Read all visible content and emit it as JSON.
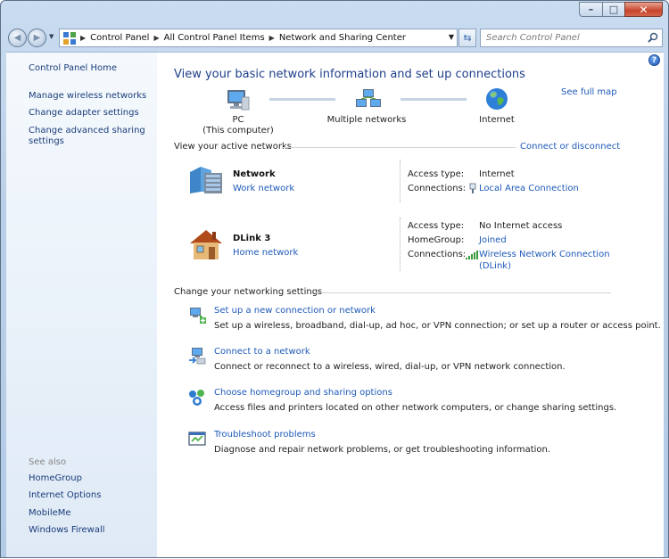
{
  "window": {
    "minimize_glyph": "–",
    "maximize_glyph": "□",
    "close_glyph": "✕"
  },
  "navbar": {
    "breadcrumbs": [
      "Control Panel",
      "All Control Panel Items",
      "Network and Sharing Center"
    ],
    "search_placeholder": "Search Control Panel"
  },
  "sidebar": {
    "home": "Control Panel Home",
    "links": [
      "Manage wireless networks",
      "Change adapter settings",
      "Change advanced sharing",
      "settings"
    ],
    "see_also_title": "See also",
    "see_also": [
      "HomeGroup",
      "Internet Options",
      "MobileMe",
      "Windows Firewall"
    ]
  },
  "main": {
    "title": "View your basic network information and set up connections",
    "see_full_map": "See full map",
    "map": {
      "pc_label": "PC",
      "pc_sub": "(This computer)",
      "middle_label": "Multiple networks",
      "internet_label": "Internet"
    },
    "active_header": "View your active networks",
    "connect_disconnect": "Connect or disconnect",
    "networks": [
      {
        "name": "Network",
        "type": "Work network",
        "access_type_label": "Access type:",
        "access_type": "Internet",
        "connections_label": "Connections:",
        "connection": "Local Area Connection"
      },
      {
        "name": "DLink  3",
        "type": "Home network",
        "access_type_label": "Access type:",
        "access_type": "No Internet access",
        "homegroup_label": "HomeGroup:",
        "homegroup": "Joined",
        "connections_label": "Connections:",
        "connection_line1": "Wireless Network Connection",
        "connection_line2": "(DLink)"
      }
    ],
    "settings_header": "Change your networking settings",
    "tasks": [
      {
        "link": "Set up a new connection or network",
        "desc": "Set up a wireless, broadband, dial-up, ad hoc, or VPN connection; or set up a router or access point.",
        "icon": "new-connection-icon"
      },
      {
        "link": "Connect to a network",
        "desc": "Connect or reconnect to a wireless, wired, dial-up, or VPN network connection.",
        "icon": "connect-network-icon"
      },
      {
        "link": "Choose homegroup and sharing options",
        "desc": "Access files and printers located on other network computers, or change sharing settings.",
        "icon": "homegroup-icon"
      },
      {
        "link": "Troubleshoot problems",
        "desc": "Diagnose and repair network problems, or get troubleshooting information.",
        "icon": "troubleshoot-icon"
      }
    ]
  },
  "colors": {
    "link": "#1e5ab8",
    "title": "#1e3f8a",
    "sidebar_link": "#1a3c7a"
  }
}
